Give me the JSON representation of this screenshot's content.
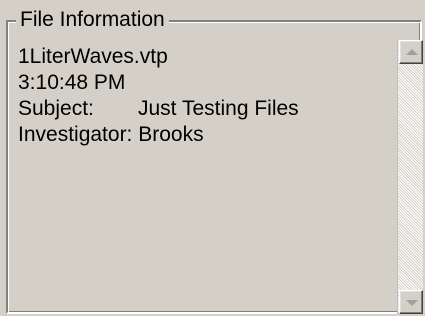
{
  "group": {
    "title": "File Information"
  },
  "file": {
    "name": "1LiterWaves.vtp",
    "time": "3:10:48 PM",
    "subject_label": "Subject:",
    "subject_value": "Just Testing Files",
    "investigator_label": "Investigator:",
    "investigator_value": "Brooks"
  },
  "scrollbar": {
    "up_icon": "scroll-up-arrow",
    "down_icon": "scroll-down-arrow",
    "state": "disabled"
  },
  "colors": {
    "panel_background": "#d4d0c8",
    "text": "#000000",
    "disabled_arrow": "#a0a0a0"
  }
}
